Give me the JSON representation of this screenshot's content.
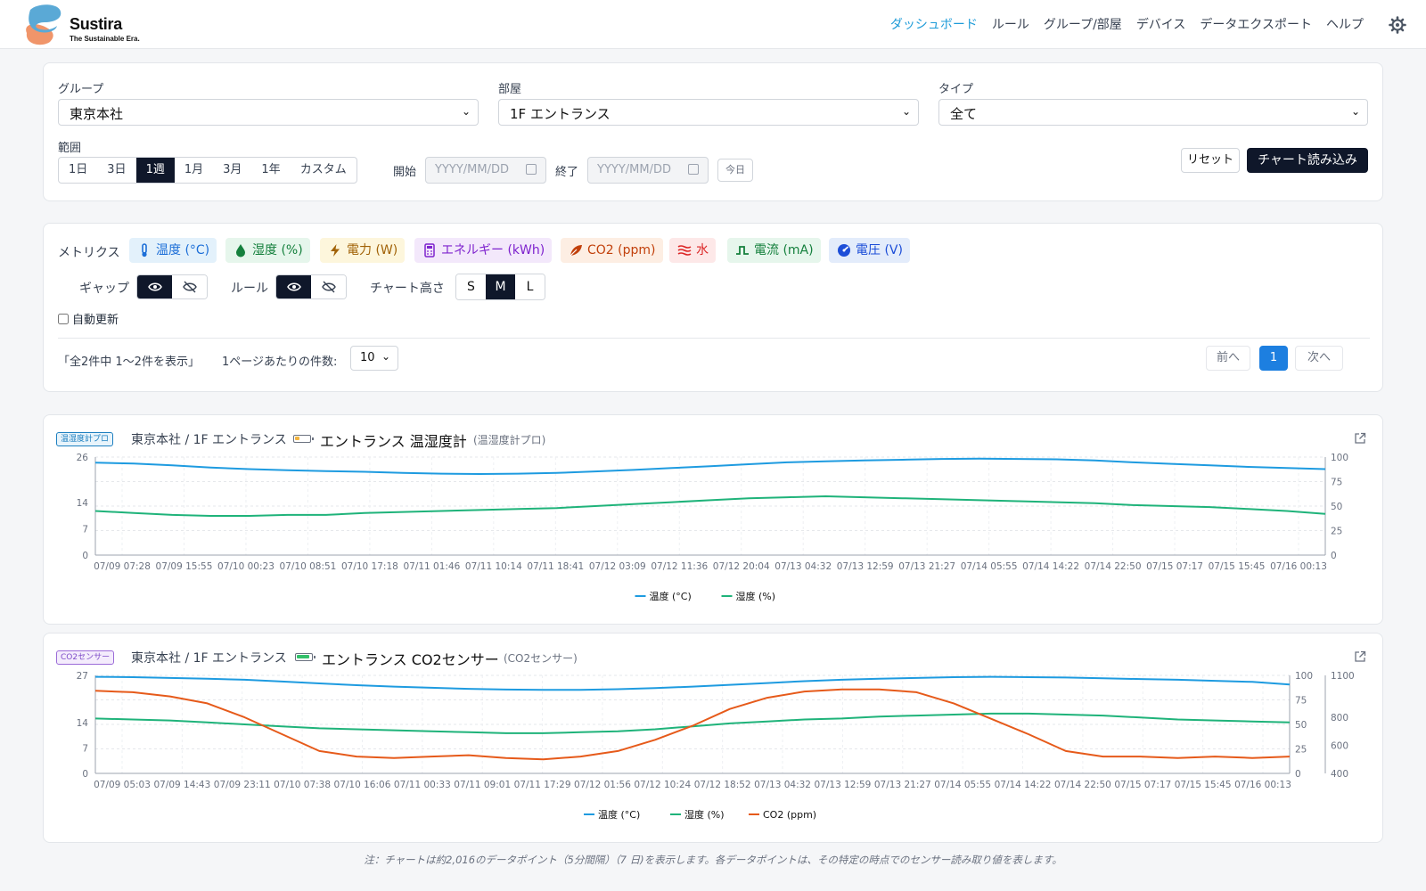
{
  "brand": {
    "name": "Sustira",
    "tagline": "The Sustainable Era."
  },
  "nav": [
    {
      "label": "ダッシュボード",
      "active": true
    },
    {
      "label": "ルール",
      "active": false
    },
    {
      "label": "グループ/部屋",
      "active": false
    },
    {
      "label": "デバイス",
      "active": false
    },
    {
      "label": "データエクスポート",
      "active": false
    },
    {
      "label": "ヘルプ",
      "active": false
    }
  ],
  "filters": {
    "group_label": "グループ",
    "group_value": "東京本社",
    "room_label": "部屋",
    "room_value": "1F エントランス",
    "type_label": "タイプ",
    "type_value": "全て",
    "range_label": "範囲",
    "ranges": [
      "1日",
      "3日",
      "1週",
      "1月",
      "3月",
      "1年",
      "カスタム"
    ],
    "range_active": "1週",
    "start_label": "開始",
    "end_label": "終了",
    "date_placeholder": "YYYY/MM/DD",
    "today": "今日",
    "reset": "リセット",
    "load": "チャート読み込み"
  },
  "metrics": {
    "label": "メトリクス",
    "chips": [
      {
        "label": "温度 (°C)",
        "color": "#1d6fd8",
        "bg": "#e3f1fb",
        "icon": "thermometer-icon"
      },
      {
        "label": "湿度 (%)",
        "color": "#15803d",
        "bg": "#e6f6ec",
        "icon": "water-drop-icon"
      },
      {
        "label": "電力 (W)",
        "color": "#a16207",
        "bg": "#fdf6dc",
        "icon": "lightning-icon"
      },
      {
        "label": "エネルギー (kWh)",
        "color": "#7e22ce",
        "bg": "#f3e8fb",
        "icon": "calculator-icon"
      },
      {
        "label": "CO2 (ppm)",
        "color": "#c2410c",
        "bg": "#fdeee3",
        "icon": "leaf-icon"
      },
      {
        "label": "水",
        "color": "#dc2626",
        "bg": "#fde8e8",
        "icon": "water-waves-icon"
      },
      {
        "label": "電流 (mA)",
        "color": "#15803d",
        "bg": "#e6f6ec",
        "icon": "pulse-icon"
      },
      {
        "label": "電圧 (V)",
        "color": "#1d4ed8",
        "bg": "#e3ecfb",
        "icon": "gauge-icon"
      }
    ],
    "gap_label": "ギャップ",
    "rule_label": "ルール",
    "height_label": "チャート高さ",
    "heights": [
      "S",
      "M",
      "L"
    ],
    "height_active": "M",
    "auto_refresh": "自動更新"
  },
  "pagination": {
    "summary": "「全2件中 1〜2件を表示」",
    "per_page_label": "1ページあたりの件数:",
    "per_page": "10",
    "prev": "前へ",
    "page": "1",
    "next": "次へ"
  },
  "devices": [
    {
      "tag": "温湿度計プロ",
      "location": "東京本社 / 1F エントランス",
      "name": "エントランス 温湿度計",
      "model": "(温湿度計プロ)",
      "battery_level": 0.35,
      "battery_color": "#f2b441"
    },
    {
      "tag": "CO2センサー",
      "location": "東京本社 / 1F エントランス",
      "name": "エントランス CO2センサー",
      "model": "(CO2センサー)",
      "battery_level": 0.9,
      "battery_color": "#34c06a"
    }
  ],
  "chart_data": [
    {
      "type": "line",
      "x_ticks": [
        "07/09 07:28",
        "07/09 15:55",
        "07/10 00:23",
        "07/10 08:51",
        "07/10 17:18",
        "07/11 01:46",
        "07/11 10:14",
        "07/11 18:41",
        "07/12 03:09",
        "07/12 11:36",
        "07/12 20:04",
        "07/13 04:32",
        "07/13 12:59",
        "07/13 21:27",
        "07/14 05:55",
        "07/14 14:22",
        "07/14 22:50",
        "07/15 07:17",
        "07/15 15:45",
        "07/16 00:13"
      ],
      "y_left_ticks": [
        0,
        7,
        14,
        26
      ],
      "y_right_ticks": [
        0,
        25,
        50,
        75,
        100
      ],
      "y_left_range": [
        0,
        26
      ],
      "y_right_range": [
        0,
        100
      ],
      "grid": true,
      "legend": "bottom-center",
      "series": [
        {
          "name": "温度 (°C)",
          "axis": "left",
          "color": "#1e9be0",
          "values": [
            24.5,
            24.3,
            23.8,
            23.2,
            22.8,
            22.5,
            22.3,
            22.1,
            21.8,
            21.6,
            21.5,
            21.6,
            21.8,
            22.2,
            22.6,
            23.1,
            23.6,
            24.1,
            24.6,
            24.9,
            25.1,
            25.3,
            25.5,
            25.6,
            25.5,
            25.4,
            25.1,
            24.6,
            24.2,
            23.8,
            23.4,
            23.1,
            22.8
          ]
        },
        {
          "name": "湿度 (%)",
          "axis": "right",
          "color": "#1fb37a",
          "values": [
            45,
            43,
            41,
            40,
            40,
            41,
            41,
            43,
            44,
            45,
            46,
            47,
            48,
            50,
            52,
            54,
            56,
            58,
            59,
            60,
            59,
            58,
            57,
            56,
            55,
            54,
            53,
            51,
            50,
            49,
            47,
            45,
            42
          ]
        }
      ]
    },
    {
      "type": "line",
      "x_ticks": [
        "07/09 05:03",
        "07/09 14:43",
        "07/09 23:11",
        "07/10 07:38",
        "07/10 16:06",
        "07/11 00:33",
        "07/11 09:01",
        "07/11 17:29",
        "07/12 01:56",
        "07/12 10:24",
        "07/12 18:52",
        "07/13 04:32",
        "07/13 12:59",
        "07/13 21:27",
        "07/14 05:55",
        "07/14 14:22",
        "07/14 22:50",
        "07/15 07:17",
        "07/15 15:45",
        "07/16 00:13"
      ],
      "y_left_ticks": [
        0,
        7,
        14,
        27
      ],
      "y_right_ticks": [
        0,
        25,
        50,
        75,
        100
      ],
      "y_right2_ticks": [
        400,
        600,
        800,
        1100
      ],
      "y_left_range": [
        0,
        27
      ],
      "y_right_range": [
        0,
        100
      ],
      "y_right2_range": [
        400,
        1100
      ],
      "grid": true,
      "legend": "bottom-center",
      "series": [
        {
          "name": "温度 (°C)",
          "axis": "left",
          "color": "#1e9be0",
          "values": [
            26.6,
            26.5,
            26.3,
            26.1,
            25.8,
            25.3,
            24.8,
            24.3,
            23.9,
            23.6,
            23.3,
            23.1,
            23.0,
            23.0,
            23.2,
            23.5,
            23.9,
            24.4,
            24.9,
            25.4,
            25.8,
            26.1,
            26.3,
            26.5,
            26.6,
            26.5,
            26.4,
            26.2,
            26.0,
            25.8,
            25.5,
            25.2,
            24.5
          ]
        },
        {
          "name": "湿度 (%)",
          "axis": "right",
          "color": "#1fb37a",
          "values": [
            56,
            55,
            54,
            52,
            50,
            48,
            46,
            45,
            44,
            43,
            42,
            41,
            41,
            42,
            43,
            45,
            48,
            51,
            53,
            55,
            56,
            58,
            59,
            60,
            61,
            61,
            60,
            59,
            57,
            55,
            54,
            53,
            52
          ]
        },
        {
          "name": "CO2 (ppm)",
          "axis": "right2",
          "color": "#e65a1a",
          "values": [
            990,
            980,
            950,
            900,
            800,
            680,
            560,
            520,
            510,
            520,
            530,
            510,
            500,
            520,
            560,
            640,
            740,
            860,
            940,
            985,
            1000,
            1000,
            980,
            900,
            790,
            680,
            560,
            520,
            520,
            510,
            520,
            510,
            520
          ]
        }
      ]
    }
  ],
  "footnote": "注：チャートは約2,016のデータポイント（5分間隔）（7 日)を表示します。各データポイントは、その特定の時点でのセンサー読み取り値を表します。"
}
